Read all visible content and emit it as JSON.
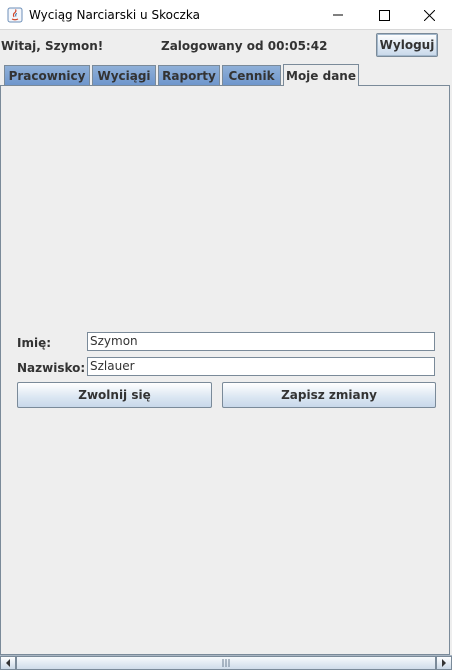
{
  "window": {
    "title": "Wyciąg Narciarski u Skoczka",
    "icons": [
      "java-app-icon",
      "minimize-icon",
      "maximize-icon",
      "close-icon"
    ]
  },
  "header": {
    "greeting": "Witaj, Szymon!",
    "session_status": "Zalogowany od 00:05:42",
    "logout_label": "Wyloguj"
  },
  "tabs": [
    {
      "label": "Pracownicy",
      "active": false
    },
    {
      "label": "Wyciągi",
      "active": false
    },
    {
      "label": "Raporty",
      "active": false
    },
    {
      "label": "Cennik",
      "active": false
    },
    {
      "label": "Moje dane",
      "active": true
    }
  ],
  "form": {
    "first_name_label": "Imię:",
    "first_name_value": "Szymon",
    "last_name_label": "Nazwisko:",
    "last_name_value": "Szlauer",
    "resign_label": "Zwolnij się",
    "save_label": "Zapisz zmiany"
  },
  "colors": {
    "tab_inactive": "#7ea2d2",
    "button_gradient_bottom": "#c8d8ea",
    "panel_background": "#eeeeee"
  }
}
